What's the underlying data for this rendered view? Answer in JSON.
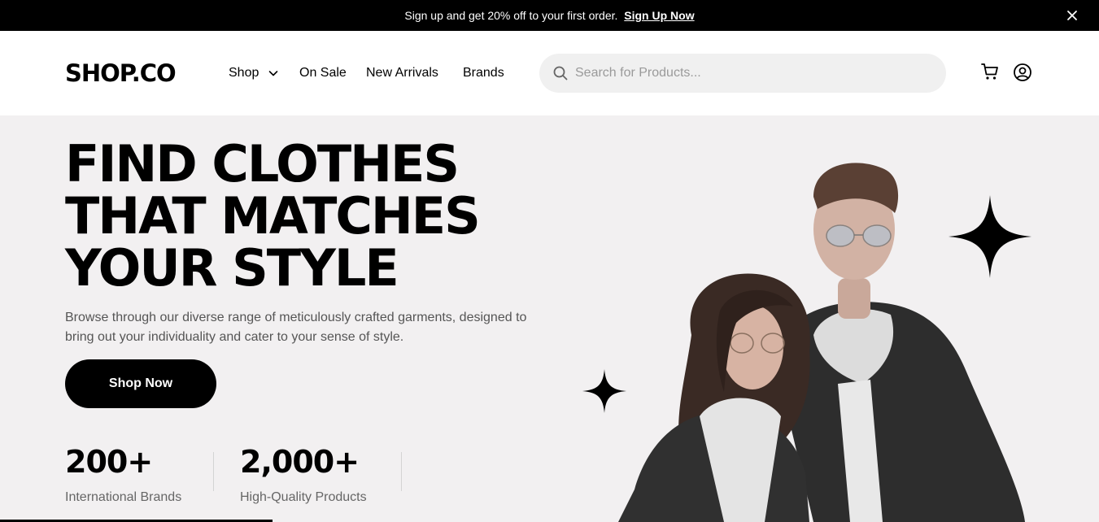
{
  "topbar": {
    "text": "Sign up and get 20% off to your first order.",
    "link": "Sign Up Now"
  },
  "header": {
    "logo": "SHOP.CO",
    "nav": {
      "shop": "Shop",
      "on_sale": "On Sale",
      "new_arrivals": "New Arrivals",
      "brands": "Brands"
    },
    "search": {
      "placeholder": "Search for Products...",
      "value": ""
    },
    "icons": [
      "search-icon",
      "cart-icon",
      "user-icon",
      "chevron-down-icon",
      "close-icon"
    ]
  },
  "hero": {
    "title_lines": [
      "FIND CLOTHES",
      "THAT MATCHES",
      "YOUR STYLE"
    ],
    "description": "Browse through our diverse range of meticulously crafted garments, designed to bring out your individuality and cater to your sense of style.",
    "cta": "Shop Now",
    "stats": [
      {
        "value": "200+",
        "label": "International Brands"
      },
      {
        "value": "2,000+",
        "label": "High-Quality Products"
      }
    ]
  },
  "colors": {
    "topbar_bg": "#000000",
    "hero_bg": "#f2f0f1",
    "search_bg": "#f0f0f0",
    "button_bg": "#000000",
    "muted_text": "#666666"
  }
}
